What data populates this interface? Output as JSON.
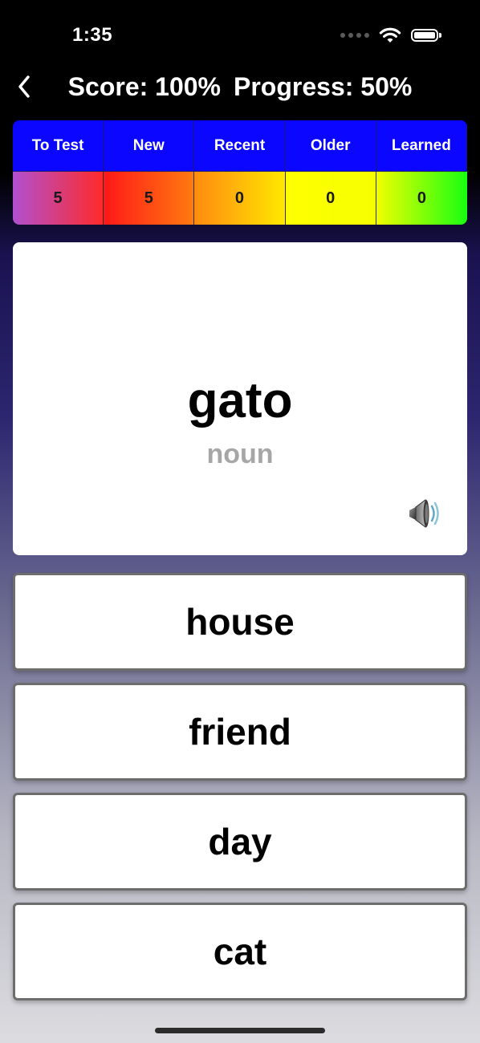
{
  "status_bar": {
    "time": "1:35"
  },
  "nav": {
    "score_text": "Score: 100%",
    "progress_text": "Progress: 50%"
  },
  "stats": {
    "headers": [
      "To Test",
      "New",
      "Recent",
      "Older",
      "Learned"
    ],
    "values": [
      "5",
      "5",
      "0",
      "0",
      "0"
    ]
  },
  "card": {
    "word": "gato",
    "part_of_speech": "noun"
  },
  "answers": [
    "house",
    "friend",
    "day",
    "cat"
  ],
  "icons": {
    "back": "chevron-left-icon",
    "speaker": "speaker-icon",
    "wifi": "wifi-icon",
    "battery": "battery-icon",
    "signal": "signal-dots-icon"
  },
  "colors": {
    "header_blue": "#0a06ff",
    "card_background": "#ffffff",
    "secondary_text": "#a6a6a6"
  }
}
